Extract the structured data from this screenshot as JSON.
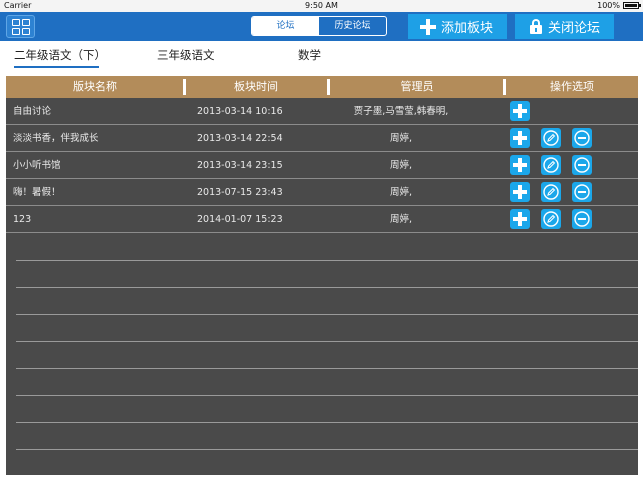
{
  "status_bar": {
    "carrier": "Carrier",
    "time": "9:50 AM",
    "battery": "100%"
  },
  "nav": {
    "segments": [
      "论坛",
      "历史论坛"
    ],
    "active_segment": 0,
    "add_block_label": "添加板块",
    "close_forum_label": "关闭论坛"
  },
  "tabs": [
    "二年级语文（下）",
    "三年级语文",
    "数学"
  ],
  "active_tab": 0,
  "table": {
    "columns": [
      "版块名称",
      "板块时间",
      "管理员",
      "操作选项"
    ],
    "rows": [
      {
        "name": "自由讨论",
        "time": "2013-03-14 10:16",
        "admins": "贾子墨,马雪莹,韩春明,",
        "actions": [
          "add"
        ]
      },
      {
        "name": "淡淡书香，伴我成长",
        "time": "2013-03-14 22:54",
        "admins": "周婷,",
        "actions": [
          "add",
          "edit",
          "delete"
        ]
      },
      {
        "name": "小小听书馆",
        "time": "2013-03-14 23:15",
        "admins": "周婷,",
        "actions": [
          "add",
          "edit",
          "delete"
        ]
      },
      {
        "name": "嗨！暑假！",
        "time": "2013-07-15 23:43",
        "admins": "周婷,",
        "actions": [
          "add",
          "edit",
          "delete"
        ]
      },
      {
        "name": "123",
        "time": "2014-01-07 15:23",
        "admins": "周婷,",
        "actions": [
          "add",
          "edit",
          "delete"
        ]
      }
    ]
  },
  "colors": {
    "nav_bg": "#1f6fc2",
    "action_button": "#1ea0e6",
    "table_header": "#b38c5a",
    "table_bg": "#4a4a4a",
    "op_button": "#1ba7ea"
  }
}
